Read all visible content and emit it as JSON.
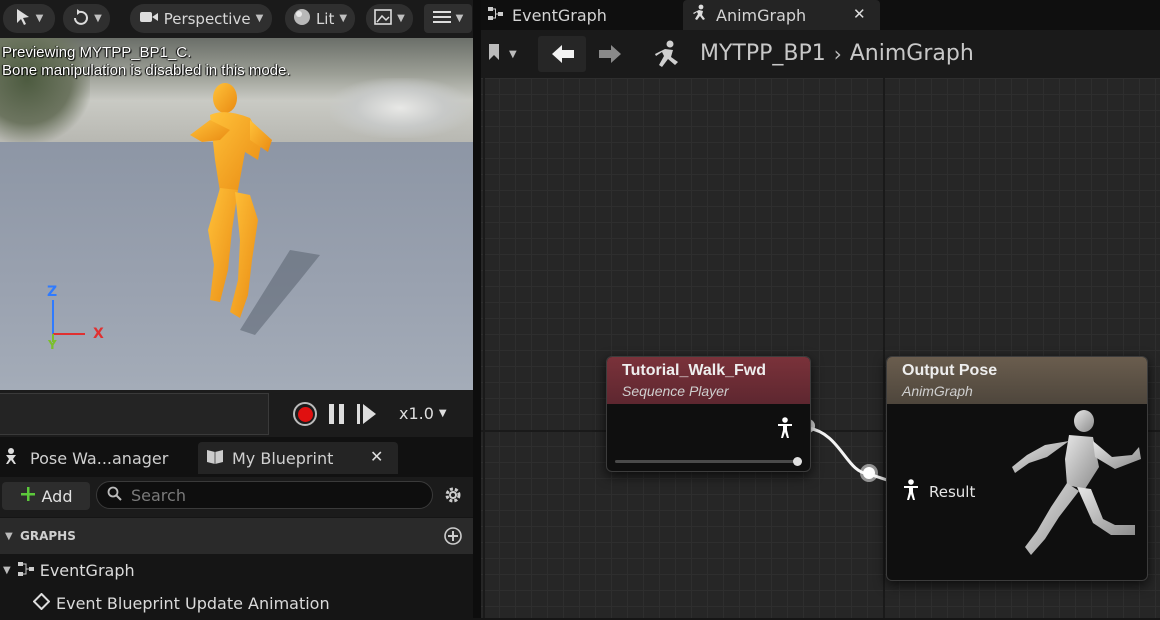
{
  "viewport": {
    "toolbar": {
      "select_icon": "select-cursor-icon",
      "transform_icon": "rotate-icon",
      "perspective_label": "Perspective",
      "lit_label": "Lit",
      "view_options_icon": "image-icon",
      "menu_icon": "hamburger-icon"
    },
    "overlay_line1": "Previewing MYTPP_BP1_C.",
    "overlay_line2": "Bone manipulation is disabled in this mode.",
    "axis": {
      "z": "Z",
      "x": "X",
      "y": "Y"
    },
    "colors": {
      "z": "#2f7bff",
      "x": "#e03030",
      "y": "#7bbf2a"
    }
  },
  "playback": {
    "speed_label": "x1.0"
  },
  "bottom_left": {
    "tabs": [
      {
        "label": "Pose Wa...anager",
        "icon": "pose-icon"
      },
      {
        "label": "My Blueprint",
        "icon": "blueprint-icon"
      }
    ],
    "add_label": "Add",
    "search_placeholder": "Search",
    "section_label": "GRAPHS",
    "tree": {
      "eventgraph_label": "EventGraph",
      "event_label": "Event Blueprint Update Animation"
    }
  },
  "graph_editor": {
    "tabs": [
      {
        "label": "EventGraph"
      },
      {
        "label": "AnimGraph"
      }
    ],
    "breadcrumb": {
      "blueprint": "MYTPP_BP1",
      "graph": "AnimGraph"
    },
    "nodes": {
      "player": {
        "title": "Tutorial_Walk_Fwd",
        "subtitle": "Sequence Player",
        "head_color": "#6e2c32"
      },
      "output": {
        "title": "Output Pose",
        "subtitle": "AnimGraph",
        "head_color": "#5c5044",
        "result_label": "Result"
      }
    }
  }
}
